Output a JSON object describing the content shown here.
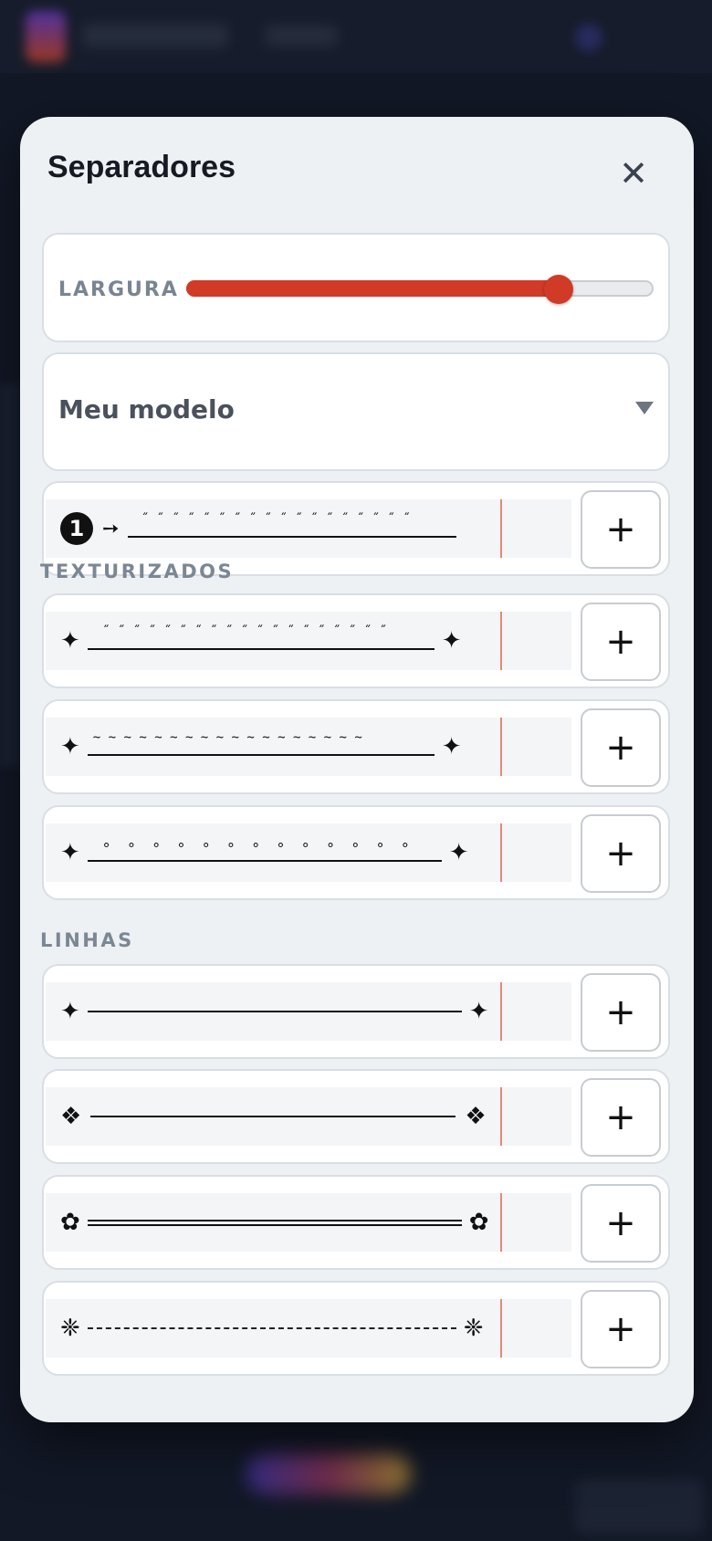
{
  "modal": {
    "title": "Separadores",
    "close_glyph": "✕",
    "slider": {
      "label": "LARGURA",
      "value_fraction": 0.8
    },
    "template_select": {
      "value": "Meu modelo"
    },
    "custom_row": {
      "badge": "1",
      "arrow": "➙",
      "marks": "˝ ˝ ˝ ˝ ˝ ˝ ˝ ˝ ˝ ˝ ˝ ˝ ˝ ˝ ˝ ˝ ˝ ˝"
    },
    "add_glyph": "+",
    "sections": [
      {
        "label": "TEXTURIZADOS",
        "rows": [
          {
            "left": "✦",
            "right": "✦",
            "marks": "˝ ˝ ˝ ˝ ˝ ˝ ˝ ˝ ˝ ˝ ˝ ˝ ˝ ˝ ˝ ˝ ˝ ˝ ˝"
          },
          {
            "left": "✦",
            "right": "✦",
            "marks": "~ ~ ~ ~ ~ ~ ~ ~ ~ ~ ~ ~ ~ ~ ~ ~ ~ ~"
          },
          {
            "left": "✦",
            "right": "✦",
            "marks": "° ° ° ° ° ° ° ° ° ° ° ° °"
          }
        ]
      },
      {
        "label": "LINHAS",
        "rows": [
          {
            "left": "✦",
            "right": "✦",
            "style": "solid"
          },
          {
            "left": "❖",
            "right": "❖",
            "style": "solid"
          },
          {
            "left": "✿",
            "right": "✿",
            "style": "double"
          },
          {
            "left": "❈",
            "right": "❈",
            "style": "dashed"
          }
        ]
      }
    ]
  },
  "icons": {
    "close": "close-icon",
    "caret": "caret-down-icon",
    "add": "plus-icon"
  },
  "colors": {
    "accent": "#d03a27",
    "panel": "#edf1f4",
    "marker": "#e28977"
  }
}
